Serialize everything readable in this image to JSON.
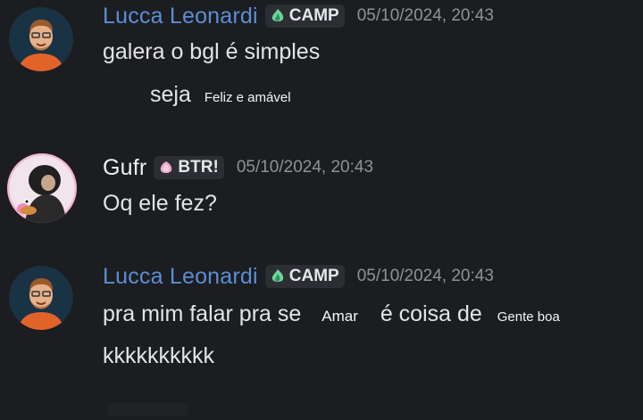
{
  "messages": [
    {
      "author": "Lucca Leonardi",
      "tag": "CAMP",
      "timestamp": "05/10/2024, 20:43",
      "line1": "galera o bgl é simples",
      "line2_word": "seja",
      "line2_note": "Feliz e amável"
    },
    {
      "author": "Gufr",
      "tag": "BTR!",
      "timestamp": "05/10/2024, 20:43",
      "line1": "Oq ele fez?"
    },
    {
      "author": "Lucca Leonardi",
      "tag": "CAMP",
      "timestamp": "05/10/2024, 20:43",
      "line1_a": "pra mim falar pra se",
      "line1_b": "Amar",
      "line1_c": "é coisa de",
      "line1_d": "Gente boa",
      "line2": "kkkkkkkkkk"
    }
  ],
  "icons": {
    "camp": "leaf-flame-icon",
    "btr": "pink-blob-icon"
  },
  "colors": {
    "background": "#1c1d20",
    "author_blue": "#5b8ed6",
    "author_white": "#eef0f3",
    "timestamp": "#8e9297",
    "tag_bg": "#2c2e33"
  }
}
